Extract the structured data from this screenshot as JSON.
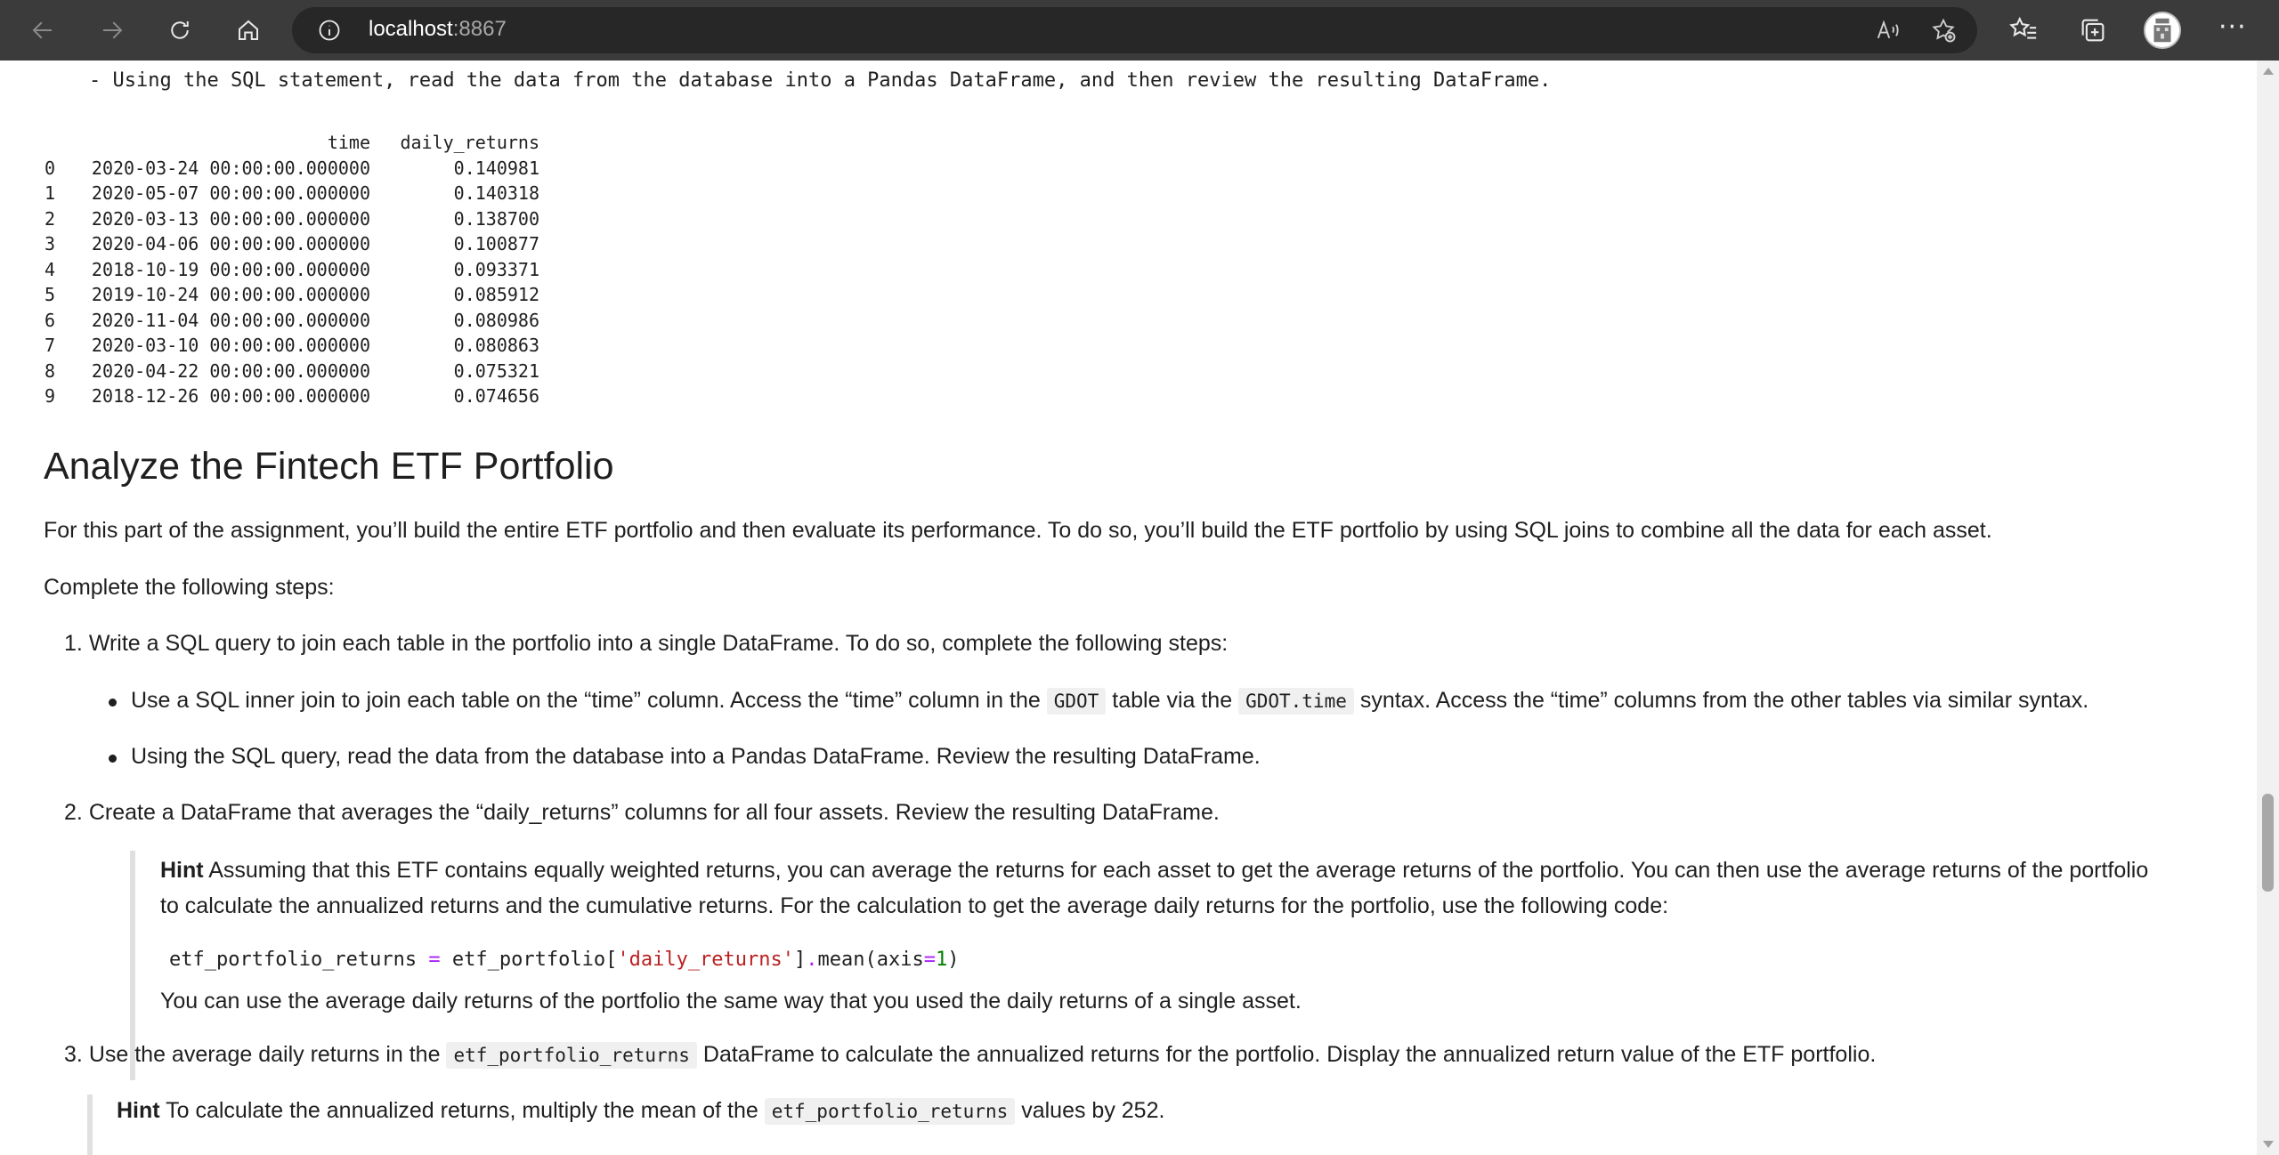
{
  "browser": {
    "url_host": "localhost",
    "url_port": ":8867",
    "icons": [
      "back-icon",
      "forward-icon",
      "refresh-icon",
      "home-icon",
      "info-icon",
      "read-aloud-icon",
      "favorite-add-icon",
      "favorites-icon",
      "collections-icon",
      "profile-avatar",
      "more-icon"
    ]
  },
  "outline_line": "- Using the SQL statement, read the data from the database into a Pandas DataFrame, and then review the resulting DataFrame.",
  "dataframe": {
    "columns": [
      "",
      "time",
      "daily_returns"
    ],
    "rows": [
      [
        "0",
        "2020-03-24 00:00:00.000000",
        "0.140981"
      ],
      [
        "1",
        "2020-05-07 00:00:00.000000",
        "0.140318"
      ],
      [
        "2",
        "2020-03-13 00:00:00.000000",
        "0.138700"
      ],
      [
        "3",
        "2020-04-06 00:00:00.000000",
        "0.100877"
      ],
      [
        "4",
        "2018-10-19 00:00:00.000000",
        "0.093371"
      ],
      [
        "5",
        "2019-10-24 00:00:00.000000",
        "0.085912"
      ],
      [
        "6",
        "2020-11-04 00:00:00.000000",
        "0.080986"
      ],
      [
        "7",
        "2020-03-10 00:00:00.000000",
        "0.080863"
      ],
      [
        "8",
        "2020-04-22 00:00:00.000000",
        "0.075321"
      ],
      [
        "9",
        "2018-12-26 00:00:00.000000",
        "0.074656"
      ]
    ]
  },
  "section": {
    "heading": "Analyze the Fintech ETF Portfolio",
    "intro": "For this part of the assignment, you’ll build the entire ETF portfolio and then evaluate its performance. To do so, you’ll build the ETF portfolio by using SQL joins to combine all the data for each asset.",
    "complete_steps": "Complete the following steps:",
    "step1": {
      "num": "1.",
      "text": "Write a SQL query to join each table in the portfolio into a single DataFrame. To do so, complete the following steps:",
      "bullet1_a": "Use a SQL inner join to join each table on the “time” column. Access the “time” column in the",
      "bullet1_code1": "GDOT",
      "bullet1_b": "table via the",
      "bullet1_code2": "GDOT.time",
      "bullet1_c": "syntax. Access the “time” columns from the other tables via similar syntax.",
      "bullet2": "Using the SQL query, read the data from the database into a Pandas DataFrame. Review the resulting DataFrame."
    },
    "step2": {
      "num": "2.",
      "text": "Create a DataFrame that averages the “daily_returns” columns for all four assets. Review the resulting DataFrame.",
      "hint_label": "Hint",
      "hint_line1": "Assuming that this ETF contains equally weighted returns, you can average the returns for each asset to get the average returns of the portfolio. You can then use the average returns of the portfolio",
      "hint_line2": "to calculate the annualized returns and the cumulative returns. For the calculation to get the average daily returns for the portfolio, use the following code:",
      "code": {
        "lhs": "etf_portfolio_returns",
        "eq": "=",
        "obj": "etf_portfolio",
        "lbr": "[",
        "key": "'daily_returns'",
        "rbr": "]",
        "dot": ".",
        "fn": "mean(axis",
        "eq2": "=",
        "arg": "1",
        "close": ")"
      },
      "after_code": "You can use the average daily returns of the portfolio the same way that you used the daily returns of a single asset."
    },
    "step3": {
      "num": "3.",
      "text_a": "Use the average daily returns in the",
      "code": "etf_portfolio_returns",
      "text_b": "DataFrame to calculate the annualized returns for the portfolio. Display the annualized return value of the ETF portfolio.",
      "hint_label": "Hint",
      "hint_a": "To calculate the annualized returns, multiply the mean of the",
      "hint_code": "etf_portfolio_returns",
      "hint_b": "values by 252."
    }
  }
}
